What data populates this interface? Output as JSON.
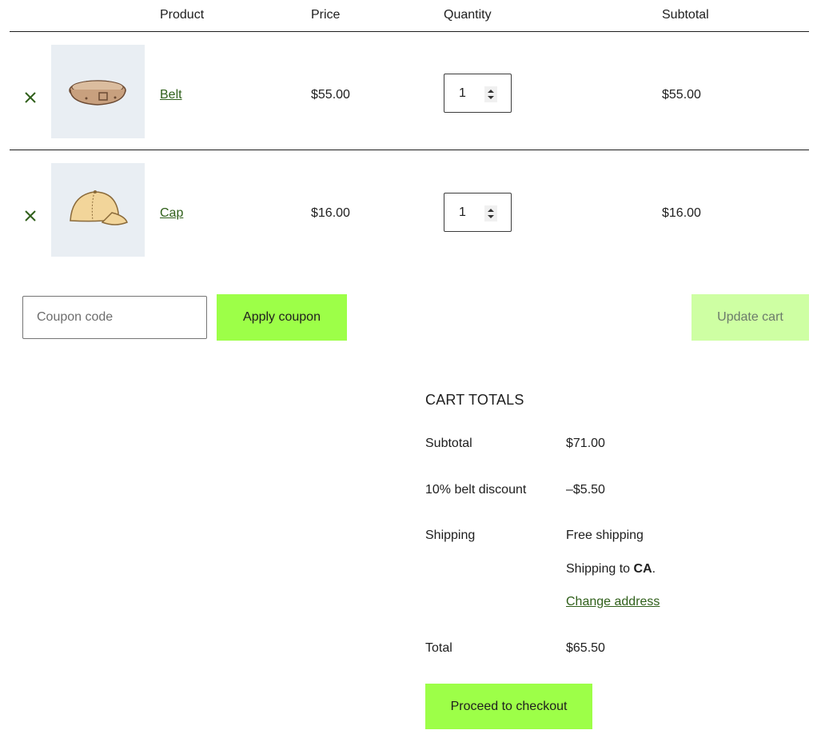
{
  "table": {
    "headers": {
      "product": "Product",
      "price": "Price",
      "quantity": "Quantity",
      "subtotal": "Subtotal"
    },
    "rows": [
      {
        "name": "Belt",
        "price": "$55.00",
        "quantity": "1",
        "subtotal": "$55.00",
        "remove_icon": "close-icon",
        "image": "belt-image"
      },
      {
        "name": "Cap",
        "price": "$16.00",
        "quantity": "1",
        "subtotal": "$16.00",
        "remove_icon": "close-icon",
        "image": "cap-image"
      }
    ]
  },
  "coupon": {
    "placeholder": "Coupon code",
    "apply_label": "Apply coupon",
    "update_label": "Update cart"
  },
  "totals": {
    "title": "CART TOTALS",
    "subtotal_label": "Subtotal",
    "subtotal_value": "$71.00",
    "discount_label": "10% belt discount",
    "discount_value": "–$5.50",
    "shipping_label": "Shipping",
    "shipping_method": "Free shipping",
    "shipping_to_prefix": "Shipping to ",
    "shipping_to_region": "CA",
    "shipping_to_suffix": ".",
    "change_address": "Change address",
    "total_label": "Total",
    "total_value": "$65.50",
    "checkout_label": "Proceed to checkout"
  },
  "colors": {
    "accent": "#9dff48",
    "accent_disabled": "#ceffa3",
    "link": "#2f5f1a",
    "thumb_bg": "#e9eef3"
  }
}
